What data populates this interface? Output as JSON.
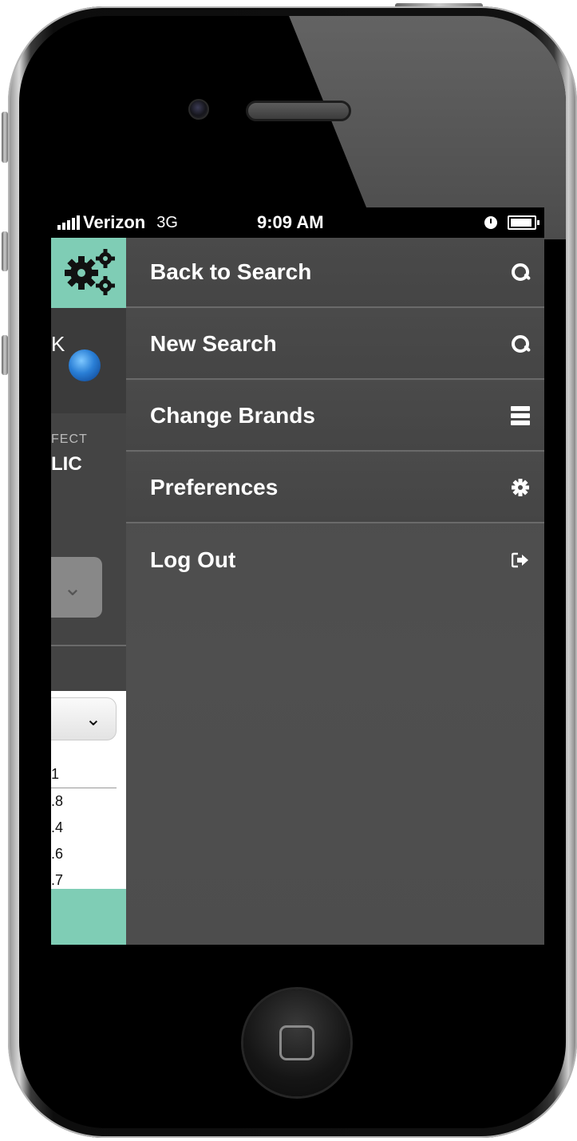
{
  "statusbar": {
    "carrier": "Verizon",
    "network": "3G",
    "time": "9:09 AM"
  },
  "background_app": {
    "partial_text_1": "K",
    "partial_text_2": "FECT",
    "partial_text_3": "LIC",
    "list_values": [
      "1",
      ".8",
      ".4",
      ".6",
      ".7"
    ]
  },
  "menu": {
    "items": [
      {
        "label": "Back to Search",
        "icon": "search-icon"
      },
      {
        "label": "New Search",
        "icon": "search-icon"
      },
      {
        "label": "Change Brands",
        "icon": "list-icon"
      },
      {
        "label": "Preferences",
        "icon": "gear-icon"
      },
      {
        "label": "Log Out",
        "icon": "logout-icon"
      }
    ]
  },
  "colors": {
    "accent": "#7fcdb5",
    "menu_bg": "#4a4a4a",
    "menu_text": "#ffffff"
  }
}
